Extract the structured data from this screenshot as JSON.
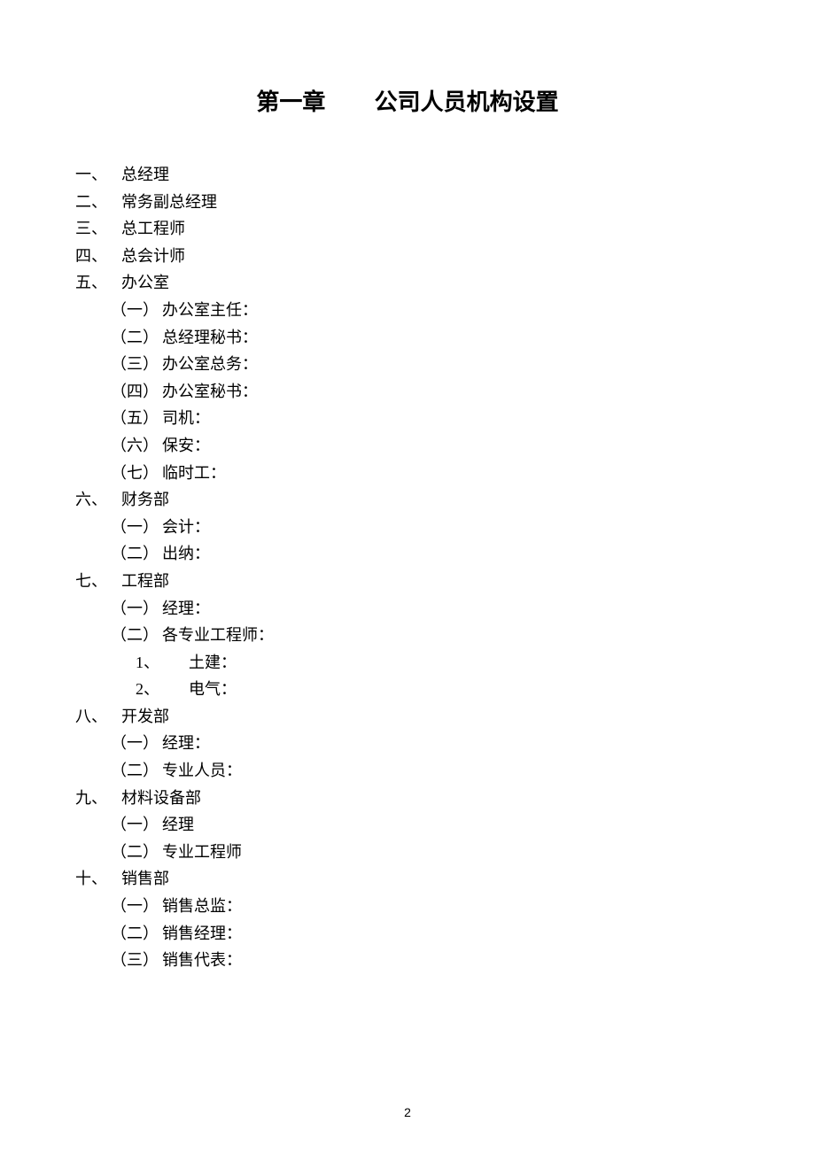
{
  "title": {
    "chapter": "第一章",
    "subtitle": "公司人员机构设置"
  },
  "items": [
    {
      "level": 1,
      "num": "一、",
      "text": "总经理"
    },
    {
      "level": 1,
      "num": "二、",
      "text": "常务副总经理"
    },
    {
      "level": 1,
      "num": "三、",
      "text": "总工程师"
    },
    {
      "level": 1,
      "num": "四、",
      "text": "总会计师"
    },
    {
      "level": 1,
      "num": "五、",
      "text": "办公室"
    },
    {
      "level": 2,
      "num": "（一）",
      "text": "办公室主任："
    },
    {
      "level": 2,
      "num": "（二）",
      "text": "总经理秘书："
    },
    {
      "level": 2,
      "num": "（三）",
      "text": "办公室总务："
    },
    {
      "level": 2,
      "num": "（四）",
      "text": "办公室秘书："
    },
    {
      "level": 2,
      "num": "（五）",
      "text": "司机："
    },
    {
      "level": 2,
      "num": "（六）",
      "text": "保安："
    },
    {
      "level": 2,
      "num": "（七）",
      "text": "临时工："
    },
    {
      "level": 1,
      "num": "六、",
      "text": "财务部"
    },
    {
      "level": 2,
      "num": "（一）",
      "text": "会计："
    },
    {
      "level": 2,
      "num": "（二）",
      "text": "出纳："
    },
    {
      "level": 1,
      "num": "七、",
      "text": "工程部"
    },
    {
      "level": 2,
      "num": "（一）",
      "text": "经理："
    },
    {
      "level": 2,
      "num": "（二）",
      "text": "各专业工程师："
    },
    {
      "level": 3,
      "num": "1、",
      "text": "土建："
    },
    {
      "level": 3,
      "num": "2、",
      "text": "电气："
    },
    {
      "level": 1,
      "num": "八、",
      "text": "开发部"
    },
    {
      "level": 2,
      "num": "（一）",
      "text": "经理："
    },
    {
      "level": 2,
      "num": "（二）",
      "text": "专业人员："
    },
    {
      "level": 1,
      "num": "九、",
      "text": "材料设备部"
    },
    {
      "level": 2,
      "num": "（一）",
      "text": "经理"
    },
    {
      "level": 2,
      "num": "（二）",
      "text": "专业工程师"
    },
    {
      "level": 1,
      "num": "十、",
      "text": "销售部"
    },
    {
      "level": 2,
      "num": "（一）",
      "text": "销售总监："
    },
    {
      "level": 2,
      "num": "（二）",
      "text": "销售经理："
    },
    {
      "level": 2,
      "num": "（三）",
      "text": "销售代表："
    }
  ],
  "pageNumber": "2"
}
